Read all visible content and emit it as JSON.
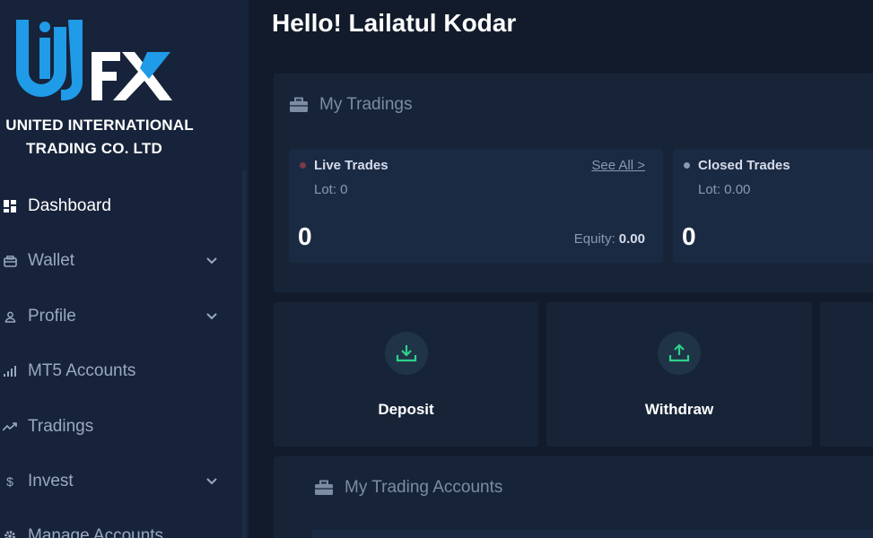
{
  "brand": {
    "line1": "UNITED INTERNATIONAL",
    "line2": "TRADING CO. LTD",
    "logo_colors": {
      "blue": "#1f9be8",
      "white": "#ffffff"
    }
  },
  "sidebar": {
    "items": [
      {
        "label": "Dashboard",
        "icon": "dashboard-icon",
        "active": true,
        "expandable": false
      },
      {
        "label": "Wallet",
        "icon": "wallet-icon",
        "active": false,
        "expandable": true
      },
      {
        "label": "Profile",
        "icon": "user-icon",
        "active": false,
        "expandable": true
      },
      {
        "label": "MT5 Accounts",
        "icon": "bar-chart-icon",
        "active": false,
        "expandable": false
      },
      {
        "label": "Tradings",
        "icon": "trend-icon",
        "active": false,
        "expandable": false
      },
      {
        "label": "Invest",
        "icon": "dollar-icon",
        "active": false,
        "expandable": true
      },
      {
        "label": "Manage Accounts",
        "icon": "gear-icon",
        "active": false,
        "expandable": false
      }
    ]
  },
  "header": {
    "greeting": "Hello! Lailatul Kodar"
  },
  "tradings": {
    "title": "My Tradings",
    "live": {
      "title": "Live Trades",
      "lot": "Lot: 0",
      "count": "0",
      "see_all": "See All >",
      "equity_label": "Equity:",
      "equity_value": "0.00",
      "dot_color": "#7a3a4a"
    },
    "closed": {
      "title": "Closed Trades",
      "lot": "Lot: 0.00",
      "count": "0",
      "dot_color": "#8a98b2"
    }
  },
  "actions": {
    "deposit": {
      "label": "Deposit",
      "icon": "download-icon"
    },
    "withdraw": {
      "label": "Withdraw",
      "icon": "upload-icon"
    },
    "accent": "#2fd08a"
  },
  "trading_accounts": {
    "title": "My Trading Accounts"
  }
}
